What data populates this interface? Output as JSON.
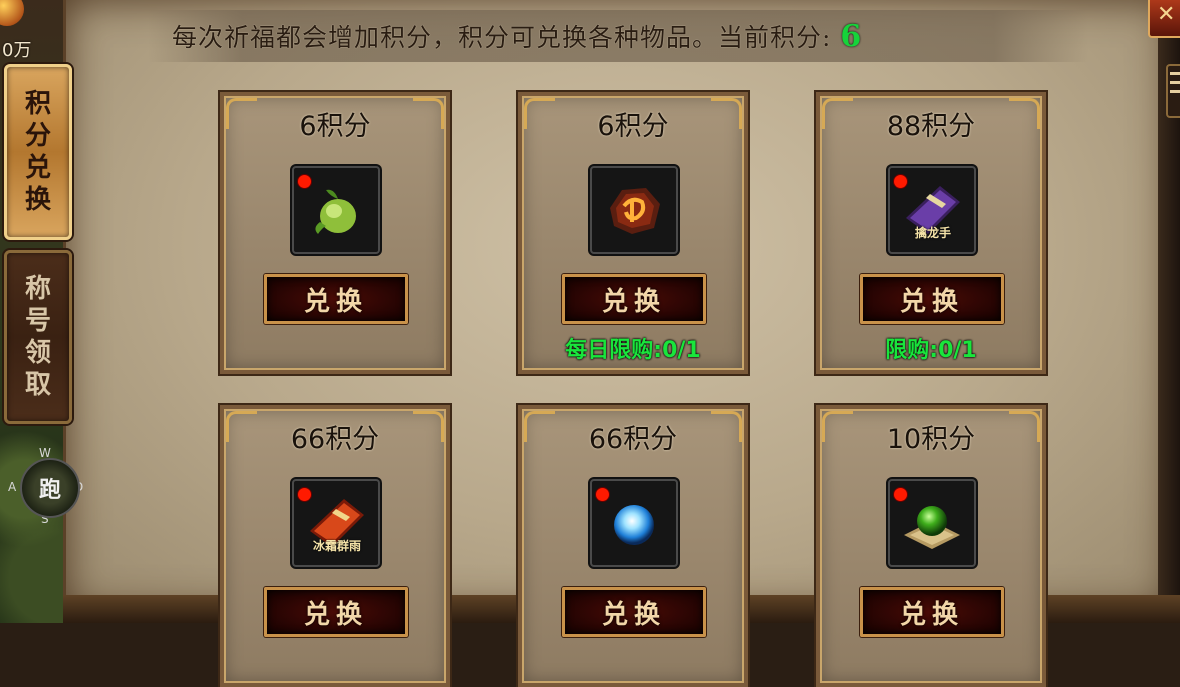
{
  "header": {
    "description": "每次祈福都会增加积分，积分可兑换各种物品。当前积分:",
    "current_points": "6"
  },
  "hud": {
    "money_fragment": "0万",
    "joystick_label": "跑",
    "joystick_keys": {
      "up": "W",
      "left": "A",
      "right": "D",
      "down": "S"
    }
  },
  "side_tabs": [
    {
      "chars": [
        "积",
        "分",
        "兑",
        "换"
      ],
      "active": true
    },
    {
      "chars": [
        "称",
        "号",
        "领",
        "取"
      ],
      "active": false
    }
  ],
  "exchange_label": "兑换",
  "items": [
    {
      "cost": "6积分",
      "icon": "green-fruit-icon",
      "has_alert": true,
      "limit": ""
    },
    {
      "cost": "6积分",
      "icon": "fire-rune-stone-icon",
      "has_alert": false,
      "limit": "每日限购:0/1"
    },
    {
      "cost": "88积分",
      "icon": "purple-skill-book-icon",
      "has_alert": true,
      "limit": "限购:0/1",
      "icon_caption": "擒龙手"
    },
    {
      "cost": "66积分",
      "icon": "red-skill-book-icon",
      "has_alert": true,
      "limit": "",
      "icon_caption": "冰霜群雨"
    },
    {
      "cost": "66积分",
      "icon": "blue-orb-icon",
      "has_alert": true,
      "limit": ""
    },
    {
      "cost": "10积分",
      "icon": "green-orb-pedestal-icon",
      "has_alert": true,
      "limit": ""
    }
  ],
  "colors": {
    "points_green": "#16d33a",
    "limit_green": "#19e53c",
    "alert_red": "#ff1a00",
    "active_tab": "#d9a55e"
  }
}
